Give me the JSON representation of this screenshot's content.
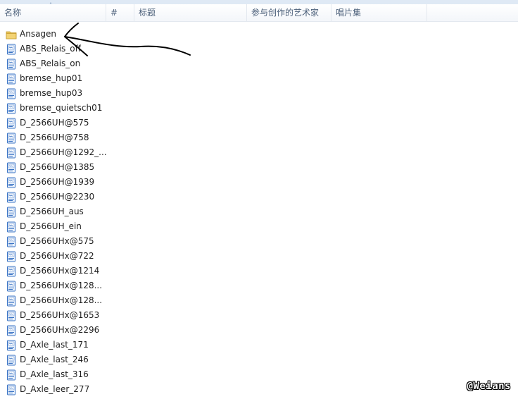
{
  "header": {
    "sort_indicator": "˄",
    "columns": [
      "名称",
      "#",
      "标题",
      "参与创作的艺术家",
      "唱片集"
    ]
  },
  "files": [
    {
      "name": "Ansagen",
      "type": "folder"
    },
    {
      "name": "ABS_Relais_off",
      "type": "audio"
    },
    {
      "name": "ABS_Relais_on",
      "type": "audio"
    },
    {
      "name": "bremse_hup01",
      "type": "audio"
    },
    {
      "name": "bremse_hup03",
      "type": "audio"
    },
    {
      "name": "bremse_quietsch01",
      "type": "audio"
    },
    {
      "name": "D_2566UH@575",
      "type": "audio"
    },
    {
      "name": "D_2566UH@758",
      "type": "audio"
    },
    {
      "name": "D_2566UH@1292_...",
      "type": "audio"
    },
    {
      "name": "D_2566UH@1385",
      "type": "audio"
    },
    {
      "name": "D_2566UH@1939",
      "type": "audio"
    },
    {
      "name": "D_2566UH@2230",
      "type": "audio"
    },
    {
      "name": "D_2566UH_aus",
      "type": "audio"
    },
    {
      "name": "D_2566UH_ein",
      "type": "audio"
    },
    {
      "name": "D_2566UHx@575",
      "type": "audio"
    },
    {
      "name": "D_2566UHx@722",
      "type": "audio"
    },
    {
      "name": "D_2566UHx@1214",
      "type": "audio"
    },
    {
      "name": "D_2566UHx@128...",
      "type": "audio"
    },
    {
      "name": "D_2566UHx@128...",
      "type": "audio"
    },
    {
      "name": "D_2566UHx@1653",
      "type": "audio"
    },
    {
      "name": "D_2566UHx@2296",
      "type": "audio"
    },
    {
      "name": "D_Axle_last_171",
      "type": "audio"
    },
    {
      "name": "D_Axle_last_246",
      "type": "audio"
    },
    {
      "name": "D_Axle_last_316",
      "type": "audio"
    },
    {
      "name": "D_Axle_leer_277",
      "type": "audio"
    }
  ],
  "icons": {
    "folder": "folder-icon",
    "audio": "audio-file-icon"
  },
  "colors": {
    "header_text": "#4c607a",
    "folder": "#e8c255",
    "audio_icon": "#3a73c4",
    "annotation_stroke": "#000000"
  },
  "watermark": "@Weians"
}
